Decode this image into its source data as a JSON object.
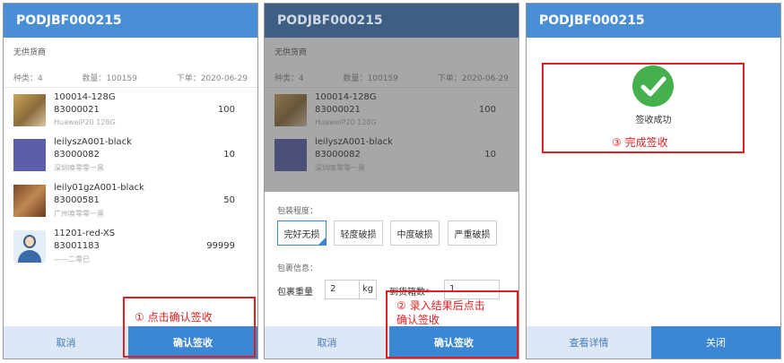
{
  "panel1": {
    "title": "PODJBF000215",
    "store": "无供货商",
    "stats": {
      "types": "种类：4",
      "count": "数量：100159",
      "order": "下单：2020-06-29"
    },
    "items": [
      {
        "name": "100014-128G",
        "code": "83000021",
        "sub": "HuaweiP20 128G",
        "qty": "100",
        "thumb": "gold"
      },
      {
        "name": "leilyszA001-black",
        "code": "83000082",
        "sub": "深圳唤零零一黑",
        "qty": "10",
        "thumb": "purple"
      },
      {
        "name": "leily01gzA001-black",
        "code": "83000581",
        "sub": "广州唤零零一黑",
        "qty": "50",
        "thumb": "bronze"
      },
      {
        "name": "11201-red-XS",
        "code": "83001183",
        "sub": "——二零已",
        "qty": "99999",
        "thumb": "avatar"
      }
    ],
    "cancel": "取消",
    "confirm": "确认签收",
    "annotation": "① 点击确认签收"
  },
  "panel2": {
    "title": "PODJBF000215",
    "store": "无供货商",
    "stats": {
      "types": "种类：4",
      "count": "数量：100159",
      "order": "下单：2020-06-29"
    },
    "items": [
      {
        "name": "100014-128G",
        "code": "83000021",
        "sub": "HuaweiP20 128G",
        "qty": "100"
      },
      {
        "name": "leilyszA001-black",
        "code": "83000082",
        "sub": "深圳唤零零一黑",
        "qty": "10"
      }
    ],
    "package_title": "包装程度：",
    "options": [
      "完好无损",
      "轻度破损",
      "中度破损",
      "严重破损"
    ],
    "package_info_title": "包裹信息：",
    "weight_label": "包裹重量",
    "weight_value": "2",
    "weight_unit": "kg",
    "boxes_label": "到货箱数",
    "required_mark": "*",
    "boxes_value": "1",
    "cancel": "取消",
    "confirm": "确认签收",
    "annotation_line1": "② 录入结果后点击",
    "annotation_line2": "确认签收"
  },
  "panel3": {
    "title": "PODJBF000215",
    "success_text": "签收成功",
    "annotation": "③ 完成签收",
    "details": "查看详情",
    "close": "关闭"
  },
  "colors": {
    "primary": "#3b87d4",
    "header": "#4a8fd6",
    "annotation": "#e02020",
    "success": "#44b04e"
  },
  "icons": {
    "success": "check-circle-icon",
    "selected": "check-corner-icon"
  }
}
